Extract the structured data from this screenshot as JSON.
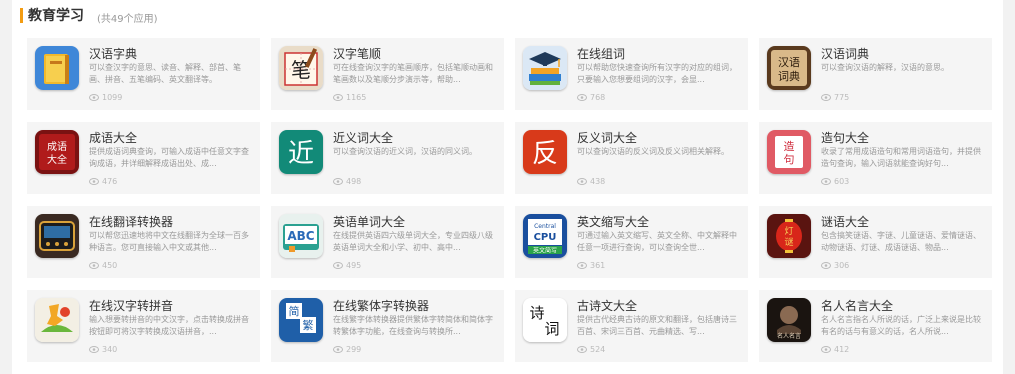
{
  "section": {
    "title": "教育学习",
    "count_label": "(共49个应用)"
  },
  "apps": [
    {
      "name": "汉语字典",
      "desc": "可以查汉字的意思、读音、解释、部首、笔画、拼音、五笔编码、英文翻译等。",
      "views": "1099",
      "icon": "dictionary-book-icon"
    },
    {
      "name": "汉字笔顺",
      "desc": "可在线查询汉字的笔画顺序，包括笔顺动画和笔画数以及笔顺分步演示等，帮助...",
      "views": "1165",
      "icon": "brush-stroke-icon"
    },
    {
      "name": "在线组词",
      "desc": "可以帮助您快速查询所有汉字的对应的组词，只要输入您想要组词的汉字，会显...",
      "views": "768",
      "icon": "books-cap-icon"
    },
    {
      "name": "汉语词典",
      "desc": "可以查询汉语的解释，汉语的意思。",
      "views": "775",
      "icon": "ci-dian-icon"
    },
    {
      "name": "成语大全",
      "desc": "提供成语词典查询，可输入成语中任意文字查询成语，并详细解释成语出处、成...",
      "views": "476",
      "icon": "chengyu-book-icon"
    },
    {
      "name": "近义词大全",
      "desc": "可以查询汉语的近义词，汉语的同义词。",
      "views": "498",
      "icon": "jin-char-icon"
    },
    {
      "name": "反义词大全",
      "desc": "可以查询汉语的反义词及反义词相关解释。",
      "views": "438",
      "icon": "fan-char-icon"
    },
    {
      "name": "造句大全",
      "desc": "收录了常用成语造句和常用词语造句，并提供造句查询，输入词语就能查询好句...",
      "views": "603",
      "icon": "zaoju-icon"
    },
    {
      "name": "在线翻译转换器",
      "desc": "可以帮您迅速地将中文在线翻译为全球一百多种语言。您可直接输入中文或其他...",
      "views": "450",
      "icon": "translator-icon"
    },
    {
      "name": "英语单词大全",
      "desc": "在线提供英语四六级单词大全，专业四级八级英语单词大全和小学、初中、高中...",
      "views": "495",
      "icon": "abc-book-icon"
    },
    {
      "name": "英文缩写大全",
      "desc": "可通过输入英文缩写、英文全称、中文解释中任意一项进行查询，可以查询全世...",
      "views": "361",
      "icon": "cpu-central-icon"
    },
    {
      "name": "谜语大全",
      "desc": "包含搞笑谜语、字谜、儿童谜语、爱情谜语、动物谜语、灯谜、成语谜语、物品...",
      "views": "306",
      "icon": "lantern-riddle-icon"
    },
    {
      "name": "在线汉字转拼音",
      "desc": "输入想要转拼音的中文汉字，点击转换成拼音按钮即可将汉字转换成汉语拼音，...",
      "views": "340",
      "icon": "pinyin-icon"
    },
    {
      "name": "在线繁体字转换器",
      "desc": "在线繁字体转换器提供繁体字转简体和简体字转繁体字功能，在线查询与转换所...",
      "views": "299",
      "icon": "jian-fan-icon"
    },
    {
      "name": "古诗文大全",
      "desc": "提供古代经典古诗的原文和翻译，包括唐诗三百首、宋词三百首、元曲精选、写...",
      "views": "524",
      "icon": "shi-ci-icon"
    },
    {
      "name": "名人名言大全",
      "desc": "名人名言指名人所说的话，广泛上来说是比较有名的话与有意义的话，名人所说...",
      "views": "412",
      "icon": "famous-quote-icon"
    }
  ],
  "icon_texts": {
    "cidian_top": "汉语",
    "cidian_bottom": "词典",
    "chengyu_top": "成语",
    "chengyu_bottom": "大全",
    "jin": "近",
    "fan": "反",
    "zao": "造",
    "ju": "句",
    "abc": "ABC",
    "cpu_top": "Central",
    "cpu_mid": "CPU",
    "cpu_bottom": "英文简写",
    "jian": "简",
    "fanti": "繁",
    "shi": "诗",
    "ci": "词",
    "deng": "灯",
    "mi": "谜",
    "mingren": "名人名言",
    "bi": "笔"
  },
  "colors": {
    "accent": "#f39c12",
    "card_bg": "#f5f5f5",
    "title": "#333333",
    "desc": "#999999"
  }
}
